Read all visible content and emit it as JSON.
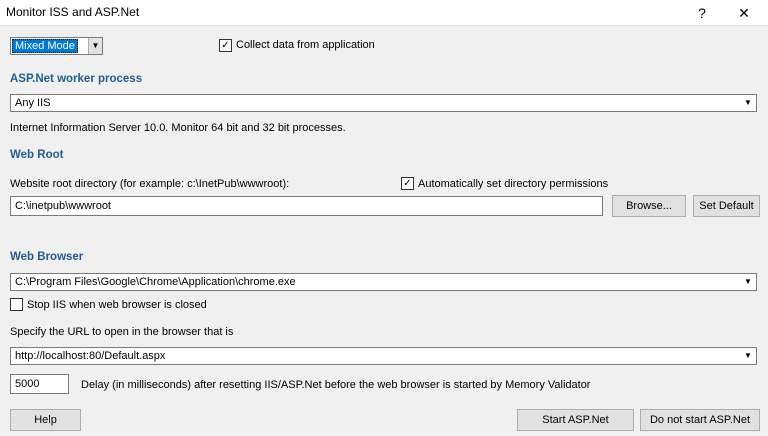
{
  "window": {
    "title": "Monitor ISS and ASP.Net",
    "help_glyph": "?",
    "close_glyph": "✕"
  },
  "mode": {
    "value": "Mixed Mode",
    "collect_label": "Collect data from application",
    "collect_checked": true
  },
  "worker": {
    "section_title": "ASP.Net worker process",
    "value": "Any IIS",
    "info": "Internet Information Server 10.0. Monitor 64 bit and 32 bit processes."
  },
  "webroot": {
    "section_title": "Web Root",
    "dir_label": "Website root directory (for example: c:\\InetPub\\wwwroot):",
    "auto_label": "Automatically set directory permissions",
    "auto_checked": true,
    "dir_value": "C:\\inetpub\\wwwroot",
    "browse_label": "Browse...",
    "default_label": "Set Default"
  },
  "browser": {
    "section_title": "Web Browser",
    "path_value": "C:\\Program Files\\Google\\Chrome\\Application\\chrome.exe",
    "stop_label": "Stop IIS when web browser is closed",
    "stop_checked": false,
    "url_label": "Specify the URL to open in the browser that is",
    "url_value": "http://localhost:80/Default.aspx",
    "delay_value": "5000",
    "delay_label": "Delay (in milliseconds) after resetting IIS/ASP.Net before the web browser is started by Memory Validator"
  },
  "footer": {
    "help_label": "Help",
    "start_label": "Start ASP.Net",
    "nostart_label": "Do not start ASP.Net"
  },
  "icons": {
    "check": "✓",
    "dropdown": "▼"
  }
}
